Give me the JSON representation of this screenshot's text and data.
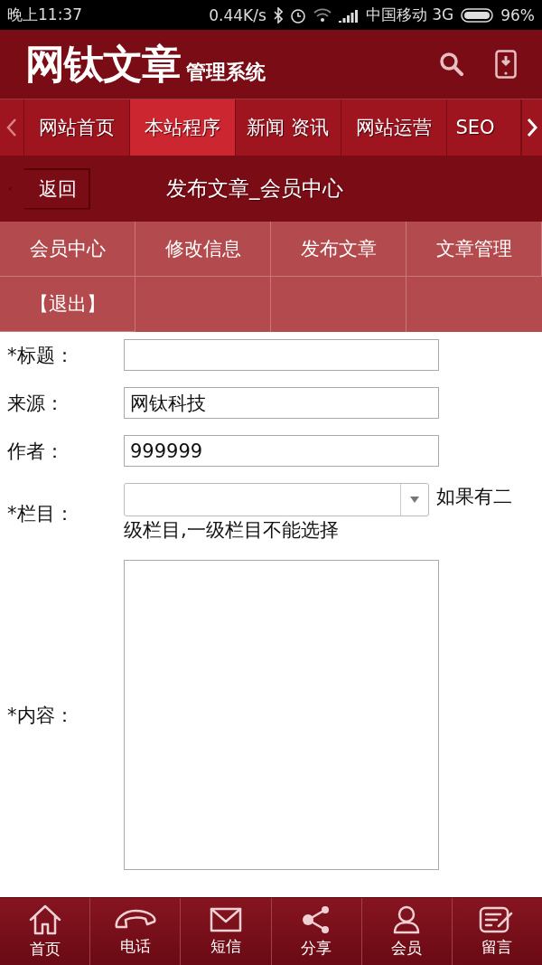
{
  "status_bar": {
    "time": "晚上11:37",
    "speed": "0.44K/s",
    "carrier": "中国移动 3G",
    "battery": "96%"
  },
  "header": {
    "logo": "网钛文章",
    "subtitle": "管理系统"
  },
  "nav_tabs": [
    {
      "label": "网站首页",
      "selected": false
    },
    {
      "label": "本站程序",
      "selected": true
    },
    {
      "label": "新闻 资讯",
      "selected": false
    },
    {
      "label": "网站运营",
      "selected": false
    },
    {
      "label": "SEO",
      "selected": false
    }
  ],
  "title_bar": {
    "back": "返回",
    "title": "发布文章_会员中心"
  },
  "member_menu": [
    "会员中心",
    "修改信息",
    "发布文章",
    "文章管理",
    "【退出】"
  ],
  "form": [
    {
      "kind": "text",
      "label": "*标题："
    },
    {
      "kind": "text",
      "label": "来源：",
      "value": "网钛科技"
    },
    {
      "kind": "text",
      "label": "作者：",
      "value": "999999"
    },
    {
      "kind": "select",
      "label": "*栏目：",
      "hint_lines": [
        "如果有二",
        "级栏目,一级栏目不能选择"
      ]
    },
    {
      "kind": "textarea",
      "label": "*内容："
    }
  ],
  "bottom_nav": [
    {
      "kind": "home",
      "label": "首页"
    },
    {
      "kind": "phone",
      "label": "电话"
    },
    {
      "kind": "mail",
      "label": "短信"
    },
    {
      "kind": "share",
      "label": "分享"
    },
    {
      "kind": "user",
      "label": "会员"
    },
    {
      "kind": "note",
      "label": "留言"
    }
  ]
}
